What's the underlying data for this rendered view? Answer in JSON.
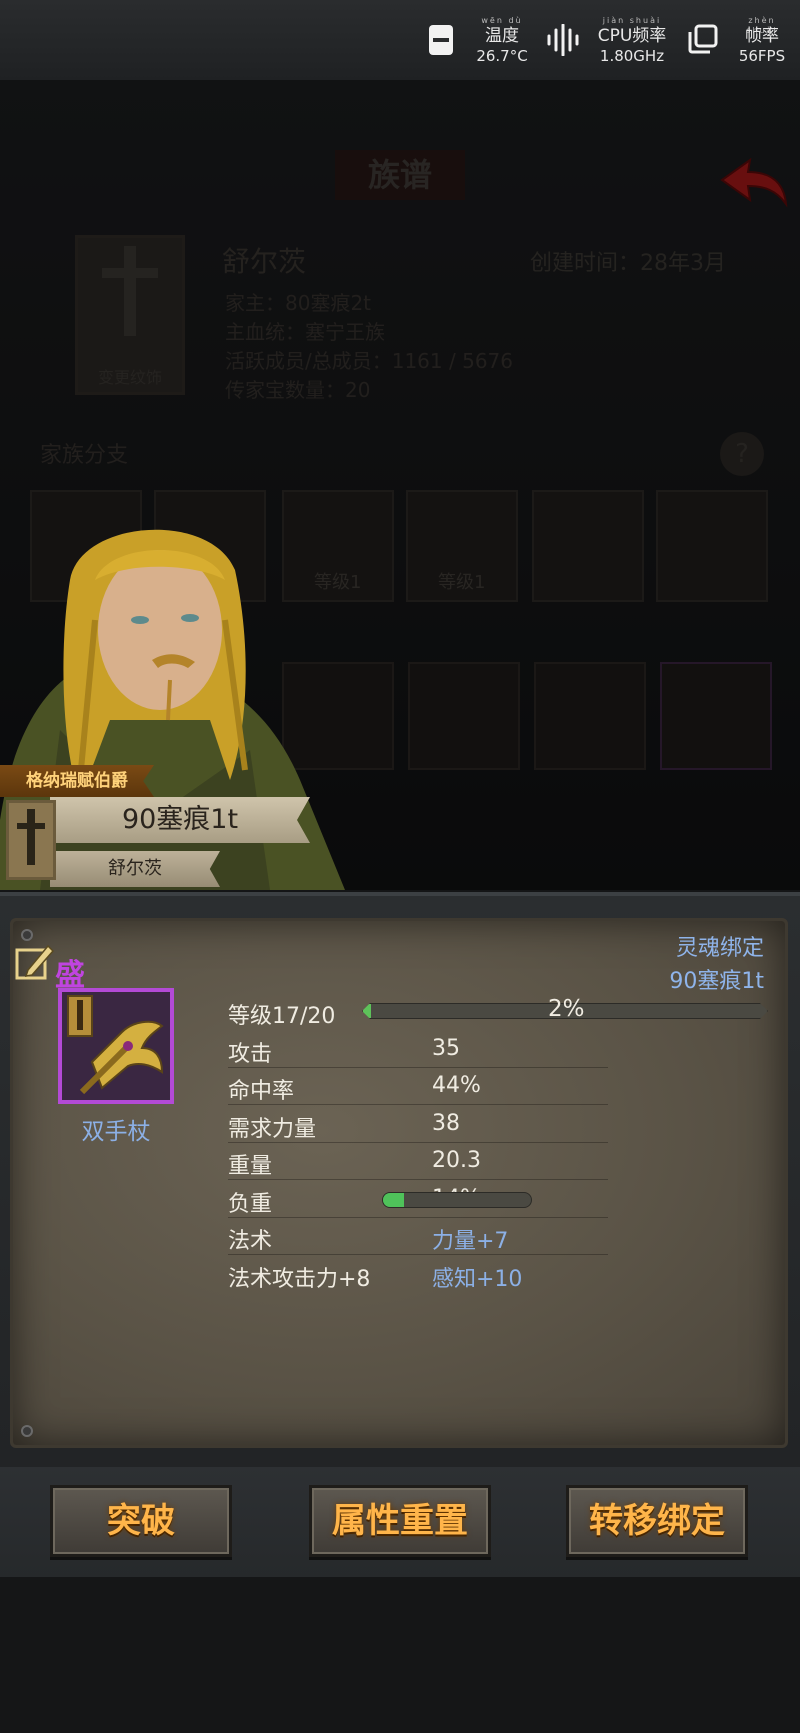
{
  "status_bar": {
    "temperature": {
      "ruby": "wēn dù",
      "label": "温度",
      "value": "26.7°C"
    },
    "cpu": {
      "ruby": "jiàn shuài",
      "label": "CPU频率",
      "value": "1.80GHz"
    },
    "fps": {
      "ruby": "zhèn shuài",
      "label": "帧率",
      "value": "56FPS"
    }
  },
  "background_screen": {
    "title": "族谱",
    "family_name": "舒尔茨",
    "created_time": "创建时间：28年3月",
    "family_head": "家主：80塞痕2t",
    "main_lineage": "主血统：塞宁王族",
    "members": "活跃成员/总成员：1161 / 5676",
    "heirlooms": "传家宝数量：20",
    "crest_caption": "变更纹饰",
    "branch_title": "家族分支",
    "help_glyph": "?",
    "branch_level_1": "等级1",
    "branch_level_2": "等级1"
  },
  "character": {
    "rank_title": "格纳瑞赋伯爵",
    "name": "90塞痕1t",
    "family": "舒尔茨"
  },
  "item": {
    "quality": "盛",
    "bind_status": "灵魂绑定",
    "bound_to": "90塞痕1t",
    "type_name": "双手杖",
    "level_label": "等级17/20",
    "level_progress_pct": "2%",
    "level_progress": 0.02,
    "load_fraction": 0.14,
    "stats": [
      {
        "key": "攻击",
        "value": "35"
      },
      {
        "key": "命中率",
        "value": "44%"
      },
      {
        "key": "需求力量",
        "value": "38"
      },
      {
        "key": "重量",
        "value": "20.3"
      },
      {
        "key": "负重",
        "value": "14%"
      },
      {
        "key": "法术",
        "value": "力量+7"
      },
      {
        "key": "法术攻击力+8",
        "value": "感知+10"
      }
    ]
  },
  "buttons": {
    "breakthrough": "突破",
    "reset_attributes": "属性重置",
    "transfer_binding": "转移绑定"
  },
  "colors": {
    "quality_purple": "#c044e0",
    "accent_blue": "#8cb0e6",
    "button_text": "#ffb54a",
    "progress_green": "#5ec25a"
  },
  "icons": [
    "battery-icon",
    "cpu-waveform-icon",
    "fps-window-icon",
    "back-arrow-icon",
    "edit-pencil-icon",
    "staff-weapon-icon",
    "family-banner-icon"
  ]
}
